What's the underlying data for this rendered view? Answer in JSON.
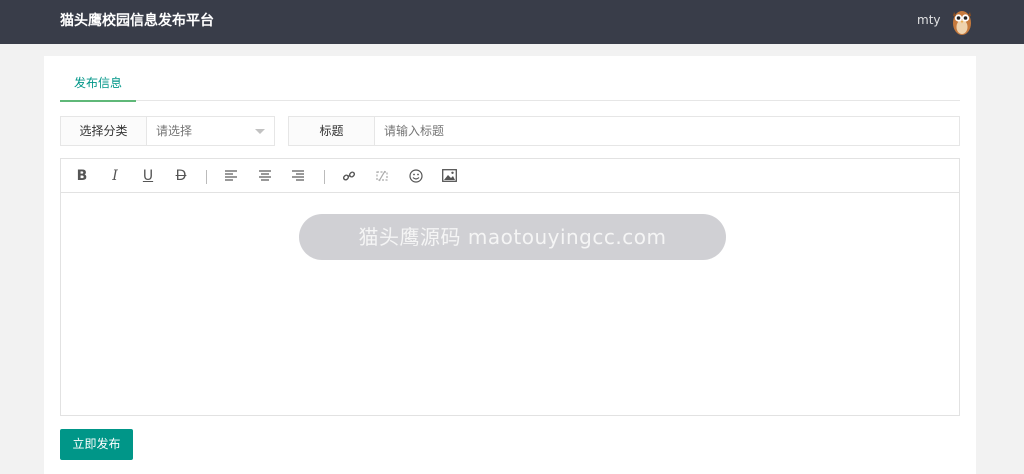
{
  "header": {
    "title": "猫头鹰校园信息发布平台",
    "username": "mty"
  },
  "tabs": [
    {
      "label": "发布信息",
      "active": true
    }
  ],
  "form": {
    "category_label": "选择分类",
    "category_placeholder": "请选择",
    "title_label": "标题",
    "title_placeholder": "请输入标题"
  },
  "editor": {
    "tools": [
      "bold-icon",
      "italic-icon",
      "underline-icon",
      "strikethrough-icon",
      "align-left-icon",
      "align-center-icon",
      "align-right-icon",
      "link-icon",
      "unlink-icon",
      "emoji-icon",
      "image-icon"
    ],
    "labels": {
      "bold": "B",
      "italic": "I",
      "underline": "U",
      "strike": "D"
    }
  },
  "watermark": "猫头鹰源码 maotouyingcc.com",
  "actions": {
    "submit_label": "立即发布"
  },
  "colors": {
    "header_bg": "#393d49",
    "accent": "#009688",
    "tab_underline": "#5fb878"
  }
}
